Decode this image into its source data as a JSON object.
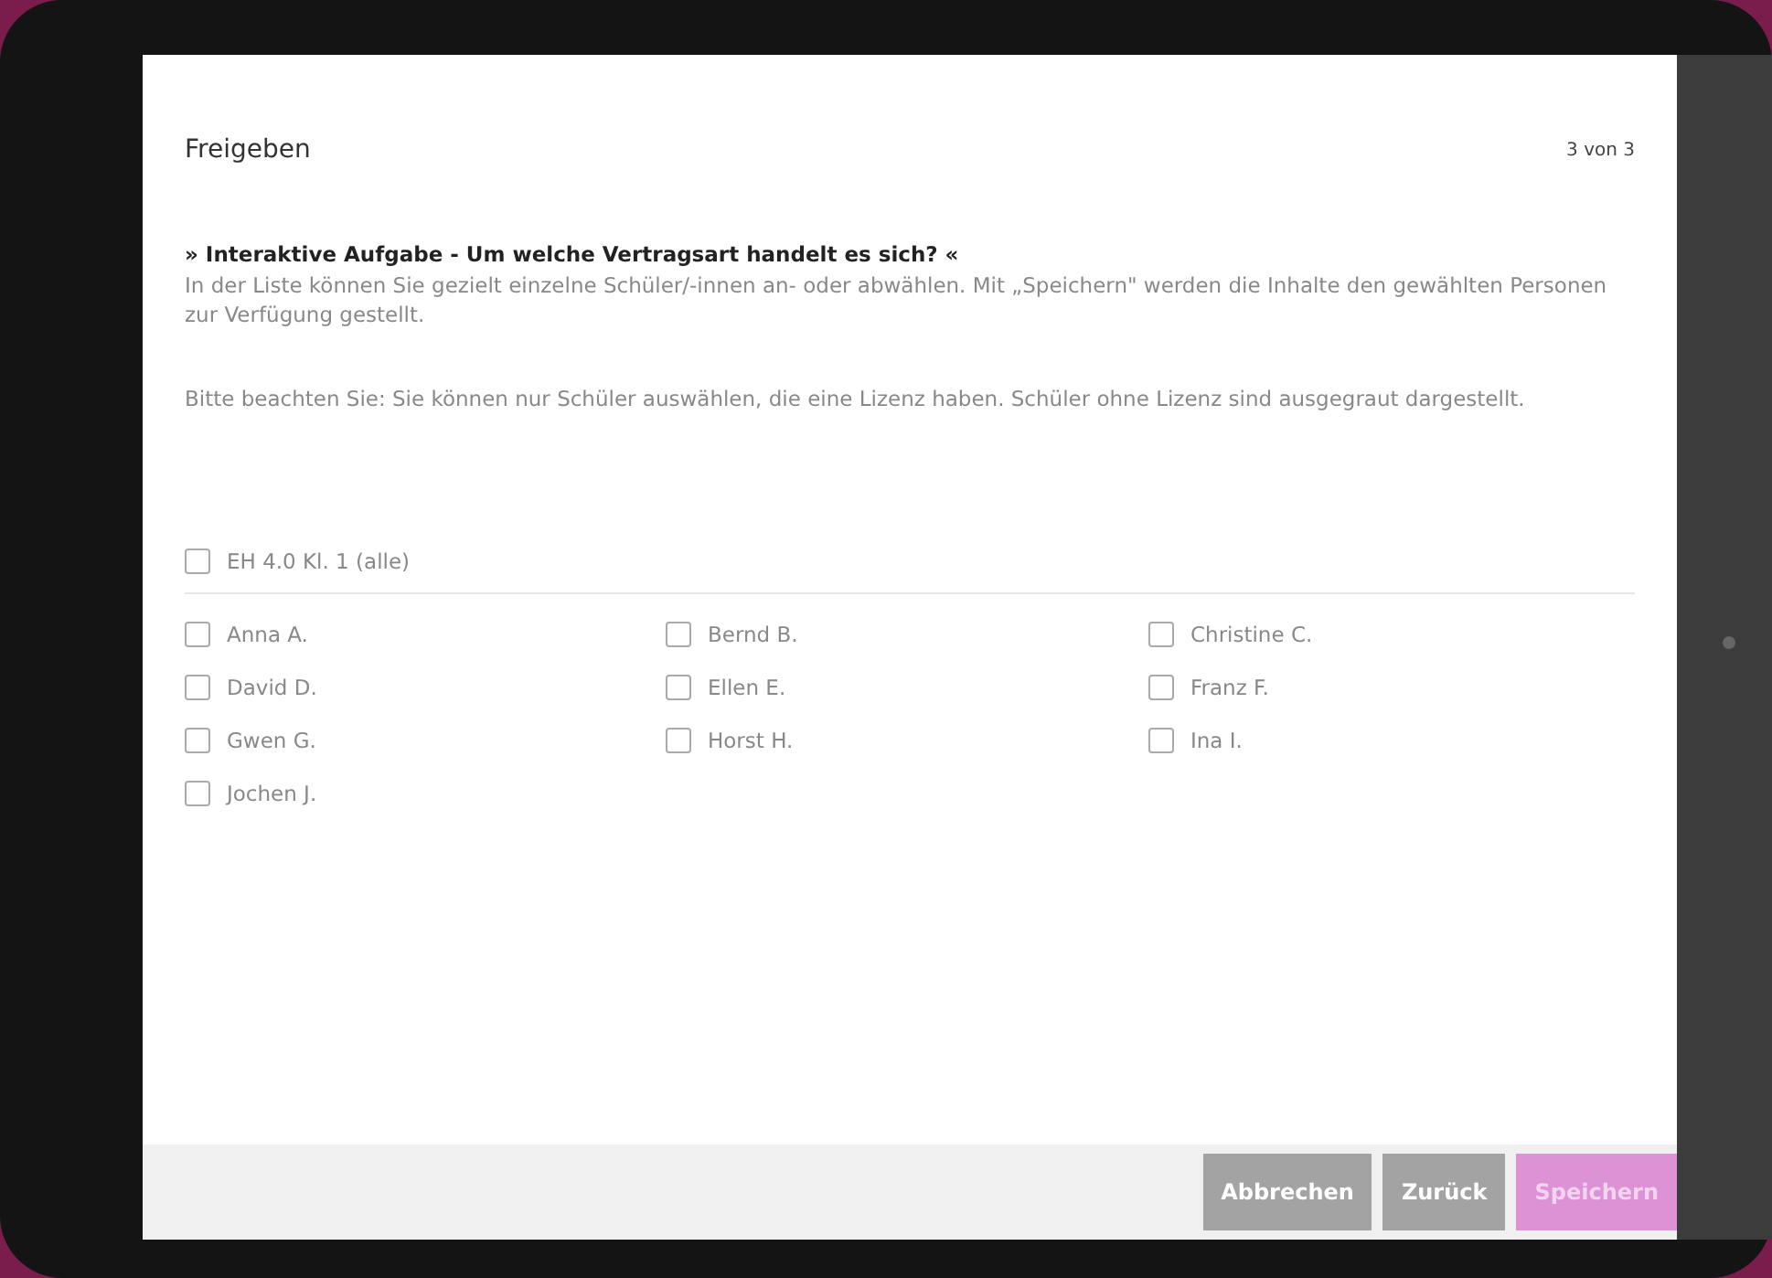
{
  "dialog": {
    "title": "Freigeben",
    "step": "3 von 3",
    "task_title": "» Interaktive Aufgabe - Um welche Vertragsart handelt es sich? «",
    "intro": "In der Liste können Sie gezielt einzelne Schüler/-innen an- oder abwählen. Mit „Speichern\" werden die Inhalte den gewählten Personen zur Verfügung gestellt.",
    "note": "Bitte beachten Sie: Sie können nur Schüler auswählen, die eine Lizenz haben. Schüler ohne Lizenz sind ausgegraut dargestellt."
  },
  "class_option": {
    "label": "EH 4.0 Kl. 1 (alle)",
    "checked": false
  },
  "students": [
    {
      "label": "Anna A.",
      "checked": false
    },
    {
      "label": "Bernd B.",
      "checked": false
    },
    {
      "label": "Christine C.",
      "checked": false
    },
    {
      "label": "David D.",
      "checked": false
    },
    {
      "label": "Ellen E.",
      "checked": false
    },
    {
      "label": "Franz F.",
      "checked": false
    },
    {
      "label": "Gwen G.",
      "checked": false
    },
    {
      "label": "Horst H.",
      "checked": false
    },
    {
      "label": "Ina I.",
      "checked": false
    },
    {
      "label": "Jochen J.",
      "checked": false
    }
  ],
  "buttons": [
    {
      "label": "Abbrechen",
      "disabled": false
    },
    {
      "label": "Zurück",
      "disabled": false
    },
    {
      "label": "Speichern",
      "disabled": true
    }
  ]
}
